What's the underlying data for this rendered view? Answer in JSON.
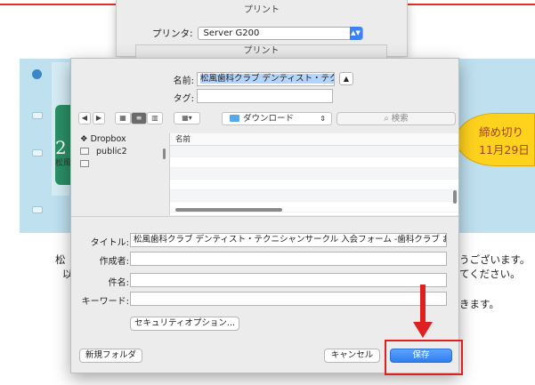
{
  "print_panel": {
    "title": "プリント",
    "printer_label": "プリンタ:",
    "printer_value": "Server G200",
    "second_title": "プリント"
  },
  "save_dialog": {
    "name_label": "名前:",
    "name_value": "松風歯科クラブ デンティスト・テクニシャン",
    "tags_label": "タグ:",
    "tags_value": "",
    "location": "ダウンロード",
    "search_placeholder": "検索",
    "sidebar_items": [
      {
        "label": "Dropbox",
        "icon": "dropbox-icon"
      },
      {
        "label": "public2",
        "icon": "folder-icon"
      },
      {
        "label": "",
        "icon": "folder-icon"
      }
    ],
    "file_list_header": "名前",
    "title_label": "タイトル:",
    "title_value": "松風歯科クラブ デンティスト・テクニシャンサークル 入会フォーム -歯科クラブ お問い",
    "author_label": "作成者:",
    "author_value": "",
    "subject_label": "件名:",
    "subject_value": "",
    "keywords_label": "キーワード:",
    "keywords_value": "",
    "security_button": "セキュリティオプション...",
    "new_folder_button": "新規フォルダ",
    "cancel_button": "キャンセル",
    "save_button": "保存"
  },
  "background_page": {
    "deadline_line1": "締め切り",
    "deadline_line2": "11月29日",
    "number": "2",
    "club_text": "松風",
    "left_text_1": "松",
    "left_text_2": "以",
    "right_text_1": "うございます。",
    "right_text_2": "てください。",
    "right_text_3": "きます。"
  },
  "colors": {
    "accent_red": "#e02020",
    "save_blue": "#2f7ef0",
    "deadline_yellow": "#ffd21e",
    "band_blue": "#bfe0ef"
  }
}
